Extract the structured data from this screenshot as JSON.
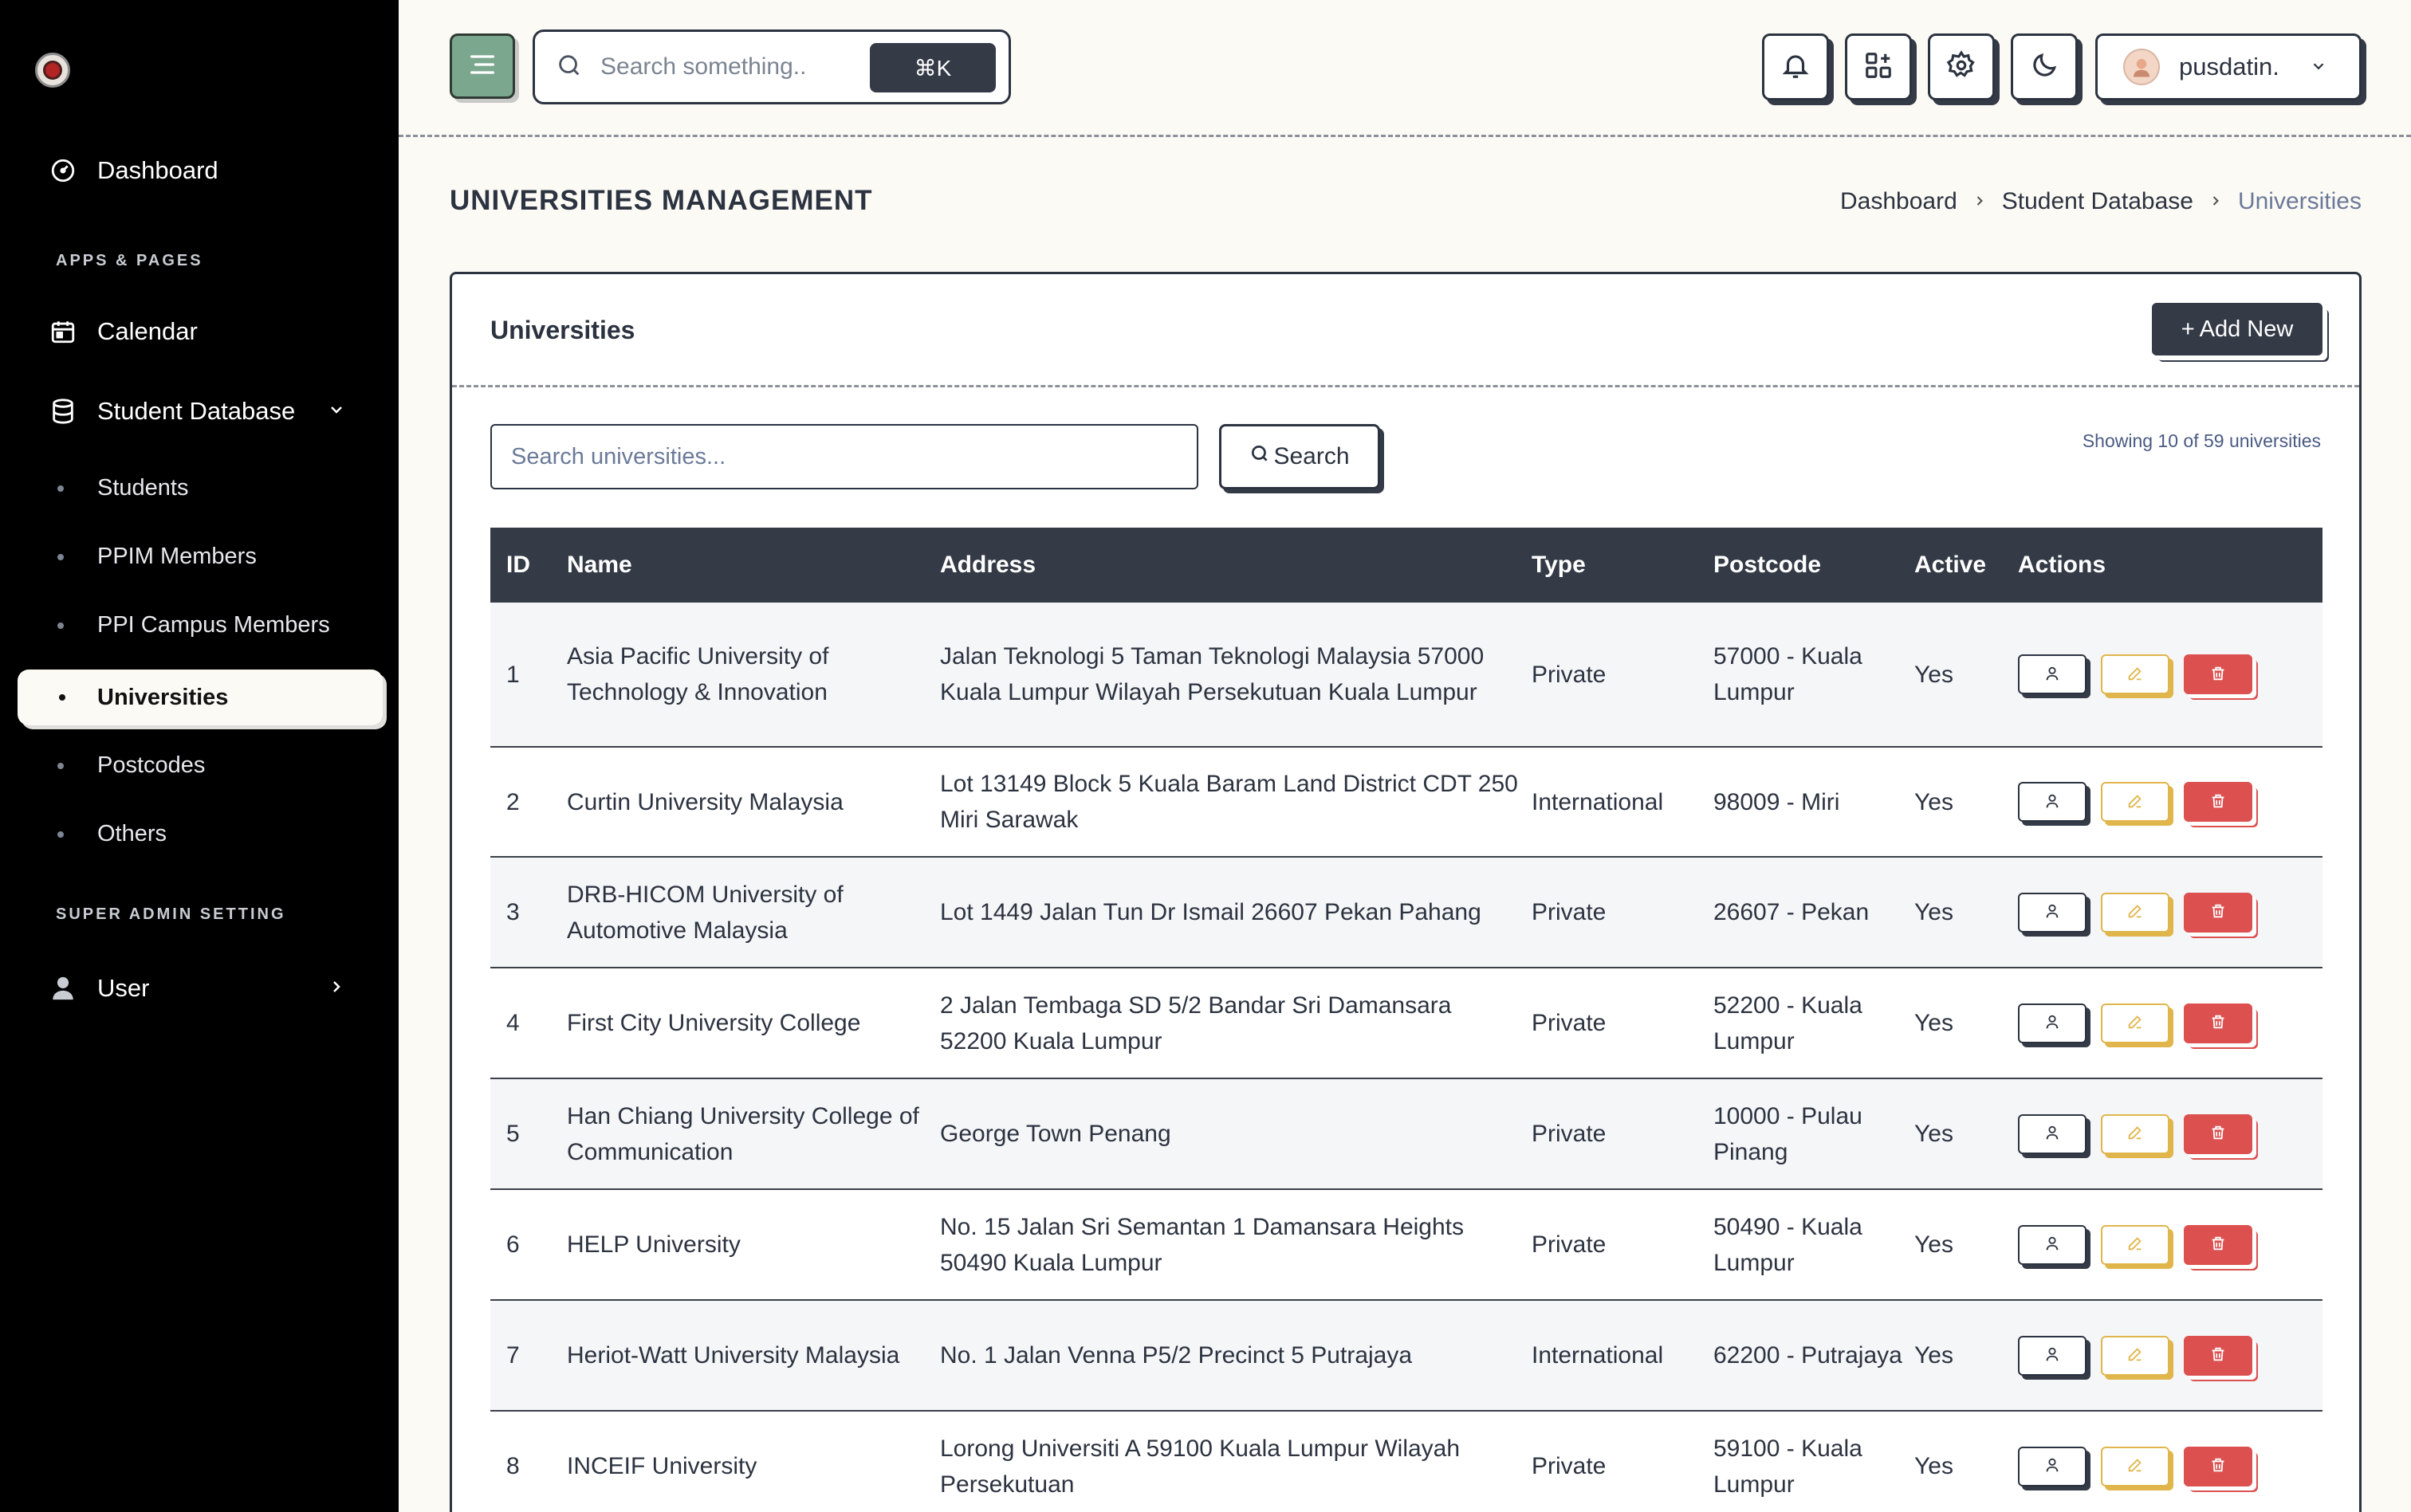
{
  "sidebar": {
    "dashboard": "Dashboard",
    "section_apps": "APPS & PAGES",
    "calendar": "Calendar",
    "student_database": "Student Database",
    "sub_items": [
      "Students",
      "PPIM Members",
      "PPI Campus Members",
      "Universities",
      "Postcodes",
      "Others"
    ],
    "section_super_admin": "SUPER ADMIN SETTING",
    "user": "User"
  },
  "header": {
    "search_placeholder": "Search something..",
    "shortcut": "⌘K",
    "username": "pusdatin."
  },
  "page": {
    "title": "UNIVERSITIES MANAGEMENT",
    "breadcrumb": [
      "Dashboard",
      "Student Database",
      "Universities"
    ]
  },
  "card": {
    "title": "Universities",
    "add_button": "Add New",
    "search_placeholder": "Search universities...",
    "search_button": "Search",
    "showing": "Showing 10 of 59 universities"
  },
  "table": {
    "columns": [
      "ID",
      "Name",
      "Address",
      "Type",
      "Postcode",
      "Active",
      "Actions"
    ],
    "rows": [
      {
        "id": "1",
        "name": "Asia Pacific University of Technology & Innovation",
        "address": "Jalan Teknologi 5 Taman Teknologi Malaysia 57000 Kuala Lumpur Wilayah Persekutuan Kuala Lumpur",
        "type": "Private",
        "postcode": "57000 - Kuala Lumpur",
        "active": "Yes"
      },
      {
        "id": "2",
        "name": "Curtin University Malaysia",
        "address": "Lot 13149 Block 5 Kuala Baram Land District CDT 250 Miri Sarawak",
        "type": "International",
        "postcode": "98009 - Miri",
        "active": "Yes"
      },
      {
        "id": "3",
        "name": "DRB-HICOM University of Automotive Malaysia",
        "address": "Lot 1449 Jalan Tun Dr Ismail 26607 Pekan Pahang",
        "type": "Private",
        "postcode": "26607 - Pekan",
        "active": "Yes"
      },
      {
        "id": "4",
        "name": "First City University College",
        "address": "2 Jalan Tembaga SD 5/2 Bandar Sri Damansara 52200 Kuala Lumpur",
        "type": "Private",
        "postcode": "52200 - Kuala Lumpur",
        "active": "Yes"
      },
      {
        "id": "5",
        "name": "Han Chiang University College of Communication",
        "address": "George Town Penang",
        "type": "Private",
        "postcode": "10000 - Pulau Pinang",
        "active": "Yes"
      },
      {
        "id": "6",
        "name": "HELP University",
        "address": "No. 15 Jalan Sri Semantan 1 Damansara Heights 50490 Kuala Lumpur",
        "type": "Private",
        "postcode": "50490 - Kuala Lumpur",
        "active": "Yes"
      },
      {
        "id": "7",
        "name": "Heriot-Watt University Malaysia",
        "address": "No. 1 Jalan Venna P5/2 Precinct 5 Putrajaya",
        "type": "International",
        "postcode": "62200 - Putrajaya",
        "active": "Yes"
      },
      {
        "id": "8",
        "name": "INCEIF University",
        "address": "Lorong Universiti A 59100 Kuala Lumpur Wilayah Persekutuan",
        "type": "Private",
        "postcode": "59100 - Kuala Lumpur",
        "active": "Yes"
      }
    ]
  },
  "colors": {
    "sidebar_bg": "#000000",
    "page_bg": "#fcfaf5",
    "table_header": "#343a46",
    "menu_button": "#7aa78e",
    "edit_accent": "#e0b64c",
    "delete_accent": "#dc5050",
    "breadcrumb_current": "#6b7a99"
  },
  "icons": [
    "dashboard-icon",
    "calendar-icon",
    "database-icon",
    "user-icon",
    "bell-icon",
    "apps-icon",
    "gear-icon",
    "moon-icon",
    "search-icon",
    "view-user-icon",
    "edit-icon",
    "trash-icon"
  ]
}
